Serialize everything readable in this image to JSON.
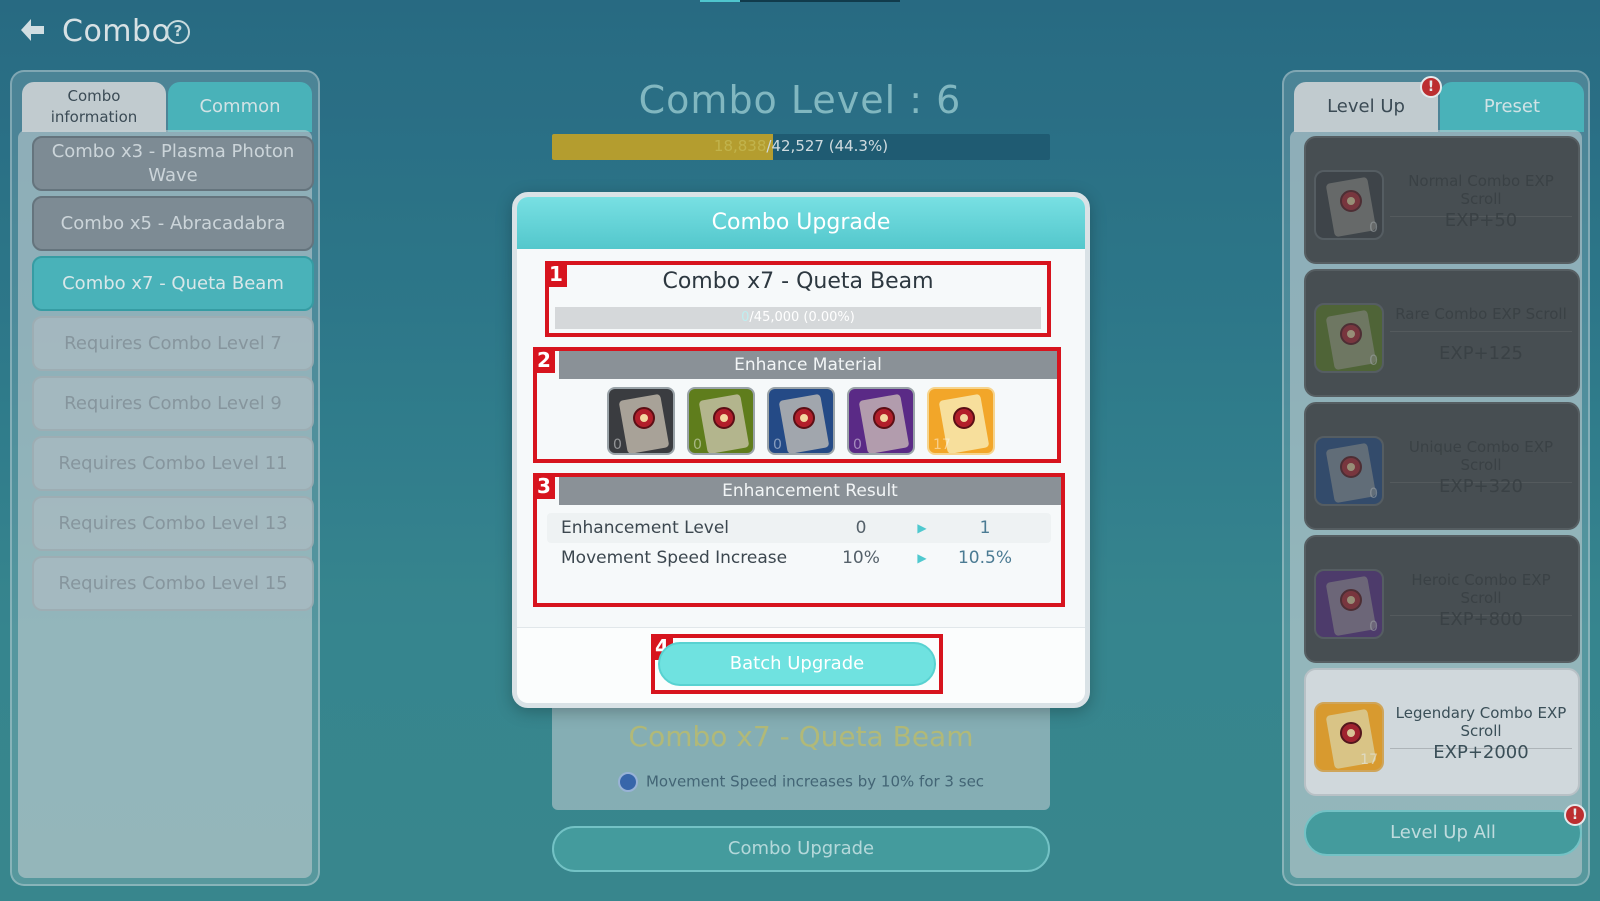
{
  "header": {
    "title": "Combo",
    "help": "?"
  },
  "left": {
    "tabs": [
      "Combo information",
      "Common"
    ],
    "items": [
      {
        "label": "Combo x3 - Plasma Photon Wave",
        "state": "unlocked"
      },
      {
        "label": "Combo x5 - Abracadabra",
        "state": "unlocked"
      },
      {
        "label": "Combo x7 - Queta Beam",
        "state": "selected"
      },
      {
        "label": "Requires Combo Level 7",
        "state": "locked"
      },
      {
        "label": "Requires Combo Level 9",
        "state": "locked"
      },
      {
        "label": "Requires Combo Level 11",
        "state": "locked"
      },
      {
        "label": "Requires Combo Level 13",
        "state": "locked"
      },
      {
        "label": "Requires Combo Level 15",
        "state": "locked"
      }
    ]
  },
  "center": {
    "level_title": "Combo Level : 6",
    "exp_current": "18,838",
    "exp_rest": "42,527 (44.3%)",
    "exp_progress": 0.443,
    "skill_name": "Combo x7 - Queta Beam",
    "skill_desc": "Movement Speed increases by 10% for 3 sec",
    "upgrade_button": "Combo Upgrade"
  },
  "right": {
    "tabs": [
      "Level Up",
      "Preset"
    ],
    "alert": "!",
    "scrolls": [
      {
        "name": "Normal Combo EXP Scroll",
        "exp": "EXP+50",
        "count": "0",
        "color": "#3a3c40"
      },
      {
        "name": "Rare Combo EXP Scroll",
        "exp": "EXP+125",
        "count": "0",
        "color": "#5f7d1c"
      },
      {
        "name": "Unique Combo EXP Scroll",
        "exp": "EXP+320",
        "count": "0",
        "color": "#244a86"
      },
      {
        "name": "Heroic Combo EXP Scroll",
        "exp": "EXP+800",
        "count": "0",
        "color": "#5a2a86"
      },
      {
        "name": "Legendary Combo EXP Scroll",
        "exp": "EXP+2000",
        "count": "17",
        "color": "#f2a629"
      }
    ],
    "level_up_all": "Level Up All"
  },
  "modal": {
    "title": "Combo Upgrade",
    "skill_name": "Combo x7 - Queta Beam",
    "skill_exp_current": "0",
    "skill_exp_rest": "45,000 (0.00%)",
    "materials_title": "Enhance Material",
    "materials": [
      {
        "count": "0",
        "color": "#3a3c40"
      },
      {
        "count": "0",
        "color": "#5f7d1c"
      },
      {
        "count": "0",
        "color": "#244a86"
      },
      {
        "count": "0",
        "color": "#5a2a86"
      },
      {
        "count": "17",
        "color": "#f2a629"
      }
    ],
    "result_title": "Enhancement Result",
    "rows": [
      {
        "label": "Enhancement Level",
        "before": "0",
        "after": "1"
      },
      {
        "label": "Movement Speed Increase",
        "before": "10%",
        "after": "10.5%"
      }
    ],
    "arrow": "▶",
    "batch_button": "Batch Upgrade",
    "markers": [
      "1",
      "2",
      "3",
      "4"
    ]
  }
}
